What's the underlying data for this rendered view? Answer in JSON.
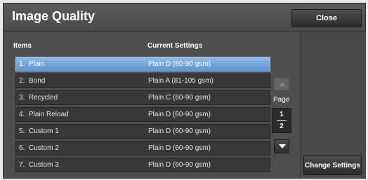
{
  "window": {
    "title": "Image Quality"
  },
  "header": {
    "close_label": "Close"
  },
  "table": {
    "headers": {
      "items": "Items",
      "current_settings": "Current Settings"
    },
    "rows": [
      {
        "num": "1.",
        "name": "Plain",
        "value": "Plain D (60-90 gsm)",
        "selected": true
      },
      {
        "num": "2.",
        "name": "Bond",
        "value": "Plain A (81-105 gsm)",
        "selected": false
      },
      {
        "num": "3.",
        "name": "Recycled",
        "value": "Plain C (60-90 gsm)",
        "selected": false
      },
      {
        "num": "4.",
        "name": "Plain Reload",
        "value": "Plain D (60-90 gsm)",
        "selected": false
      },
      {
        "num": "5.",
        "name": "Custom 1",
        "value": "Plain D (60-90 gsm)",
        "selected": false
      },
      {
        "num": "6.",
        "name": "Custom 2",
        "value": "Plain D (60-90 gsm)",
        "selected": false
      },
      {
        "num": "7.",
        "name": "Custom 3",
        "value": "Plain D (60-90 gsm)",
        "selected": false
      }
    ]
  },
  "pager": {
    "label": "Page",
    "current": "1",
    "total": "2",
    "up_icon": "triangle-up-icon",
    "down_icon": "triangle-down-icon",
    "up_enabled": false
  },
  "actions": {
    "change_settings_label": "Change Settings"
  },
  "colors": {
    "background": "#4e4e4e",
    "selected_row": "#6fa3dc",
    "row": "#383838",
    "text": "#ffffff"
  }
}
